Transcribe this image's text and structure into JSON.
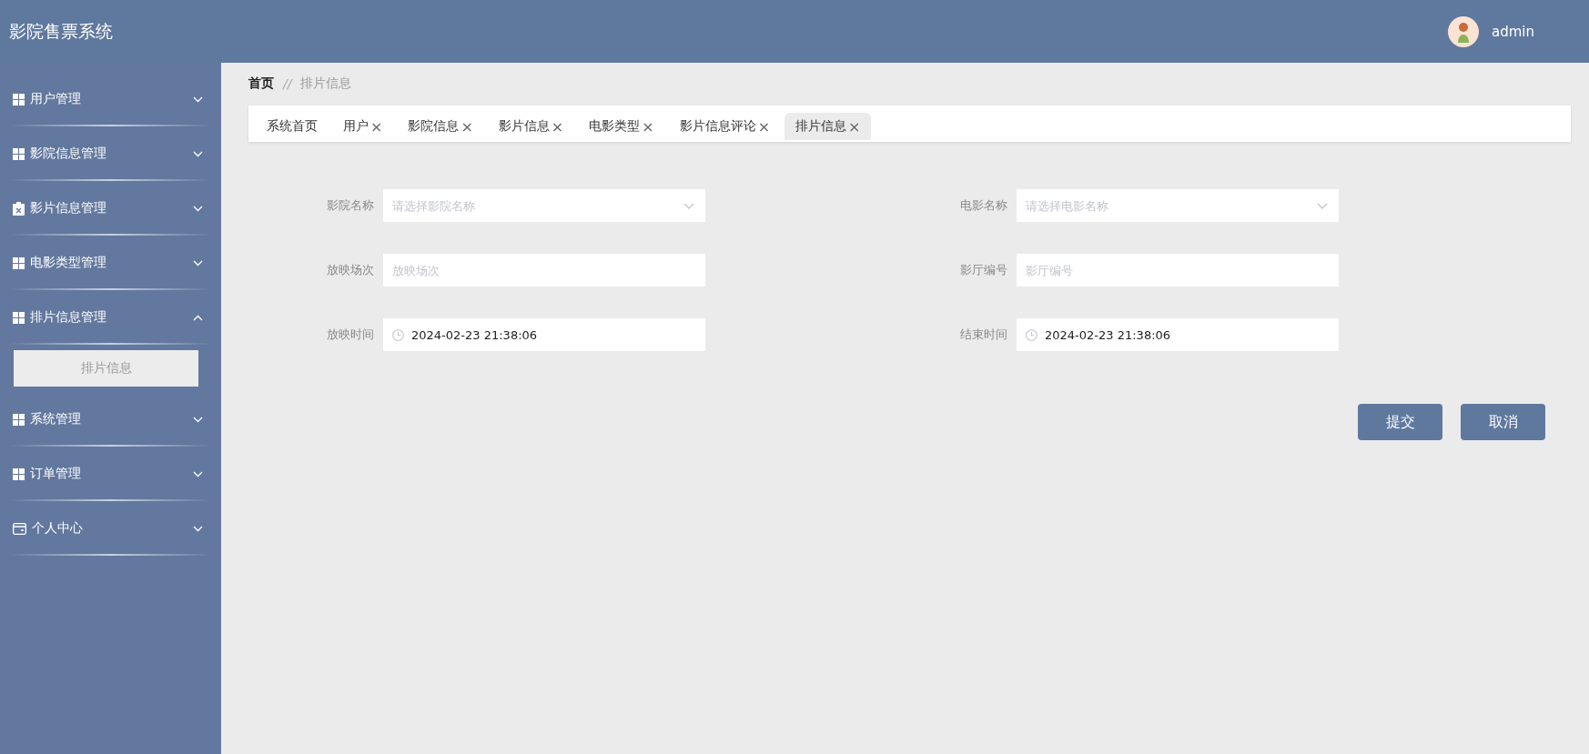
{
  "header": {
    "title": "影院售票系统",
    "user": "admin"
  },
  "sidebar": {
    "items": [
      {
        "label": "用户管理",
        "expanded": false
      },
      {
        "label": "影院信息管理",
        "expanded": false
      },
      {
        "label": "影片信息管理",
        "expanded": false
      },
      {
        "label": "电影类型管理",
        "expanded": false
      },
      {
        "label": "排片信息管理",
        "expanded": true,
        "children": [
          {
            "label": "排片信息",
            "selected": true
          }
        ]
      },
      {
        "label": "系统管理",
        "expanded": false
      },
      {
        "label": "订单管理",
        "expanded": false
      },
      {
        "label": "个人中心",
        "expanded": false
      }
    ]
  },
  "breadcrumb": {
    "home": "首页",
    "separator": "//",
    "current": "排片信息"
  },
  "tabs": [
    {
      "label": "系统首页",
      "closable": false,
      "selected": false
    },
    {
      "label": "用户",
      "closable": true,
      "selected": false
    },
    {
      "label": "影院信息",
      "closable": true,
      "selected": false
    },
    {
      "label": "影片信息",
      "closable": true,
      "selected": false
    },
    {
      "label": "电影类型",
      "closable": true,
      "selected": false
    },
    {
      "label": "影片信息评论",
      "closable": true,
      "selected": false
    },
    {
      "label": "排片信息",
      "closable": true,
      "selected": true
    }
  ],
  "close_glyph": "×",
  "form": {
    "fields": [
      {
        "label": "影院名称",
        "kind": "select",
        "placeholder": "请选择影院名称"
      },
      {
        "label": "电影名称",
        "kind": "select",
        "placeholder": "请选择电影名称"
      },
      {
        "label": "放映场次",
        "kind": "text",
        "placeholder": "放映场次"
      },
      {
        "label": "影厅编号",
        "kind": "text",
        "placeholder": "影厅编号"
      },
      {
        "label": "放映时间",
        "kind": "datetime",
        "value": "2024-02-23 21:38:06"
      },
      {
        "label": "结束时间",
        "kind": "datetime",
        "value": "2024-02-23 21:38:06"
      }
    ],
    "buttons": [
      "提交",
      "取消"
    ]
  }
}
